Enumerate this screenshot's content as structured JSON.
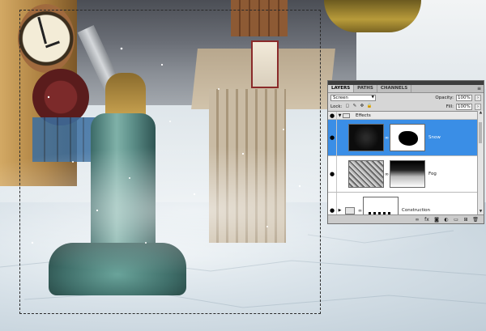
{
  "panel": {
    "tabs": [
      "LAYERS",
      "PATHS",
      "CHANNELS"
    ],
    "menu_icon": "≡",
    "blend_mode": "Screen",
    "opacity_label": "Opacity:",
    "opacity_value": "100%",
    "lock_label": "Lock:",
    "fill_label": "Fill:",
    "fill_value": "100%"
  },
  "layers": [
    {
      "name": "Effects",
      "type": "group",
      "expanded": true,
      "visible": true
    },
    {
      "name": "Snow",
      "type": "layer",
      "selected": true,
      "visible": true
    },
    {
      "name": "Fog",
      "type": "layer",
      "selected": false,
      "visible": true
    },
    {
      "name": "Construction",
      "type": "group",
      "expanded": false,
      "visible": true
    }
  ],
  "icons": {
    "eye": "●",
    "collapse": "▼",
    "expand": "▶",
    "chain": "∞",
    "scroll_up": "▲",
    "scroll_down": "▼",
    "lock_icons": [
      "◻",
      "✎",
      "✥",
      "🔒"
    ],
    "bottom": [
      "∞",
      "fx",
      "◙",
      "◐",
      "▭",
      "⊞",
      "🗑"
    ]
  },
  "colors": {
    "selected_layer": "#3a8ee6",
    "panel_bg": "#d6d6d6"
  }
}
